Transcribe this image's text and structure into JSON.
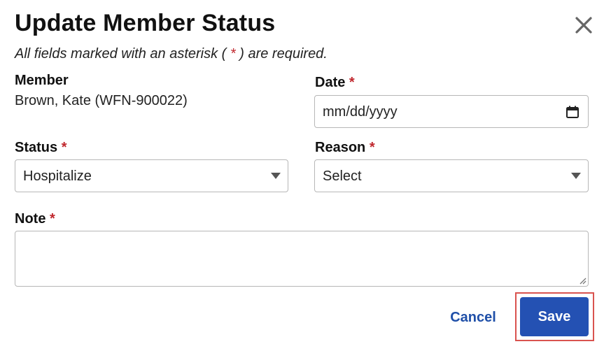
{
  "dialog": {
    "title": "Update Member Status",
    "close_icon": "close-icon",
    "required_note_prefix": "All fields marked with an asterisk (",
    "required_note_asterisk": "*",
    "required_note_suffix": ") are required."
  },
  "member": {
    "label": "Member",
    "value": "Brown, Kate (WFN-900022)"
  },
  "date": {
    "label": "Date",
    "asterisk": "*",
    "placeholder": "mm/dd/yyyy",
    "icon": "calendar-icon"
  },
  "status": {
    "label": "Status",
    "asterisk": "*",
    "selected": "Hospitalize"
  },
  "reason": {
    "label": "Reason",
    "asterisk": "*",
    "selected": "Select"
  },
  "note": {
    "label": "Note",
    "asterisk": "*",
    "value": ""
  },
  "actions": {
    "cancel_label": "Cancel",
    "save_label": "Save"
  },
  "colors": {
    "required": "#c0272d",
    "primary": "#2451b3",
    "link": "#1f4fa8",
    "highlight_outline": "#d9534f"
  }
}
